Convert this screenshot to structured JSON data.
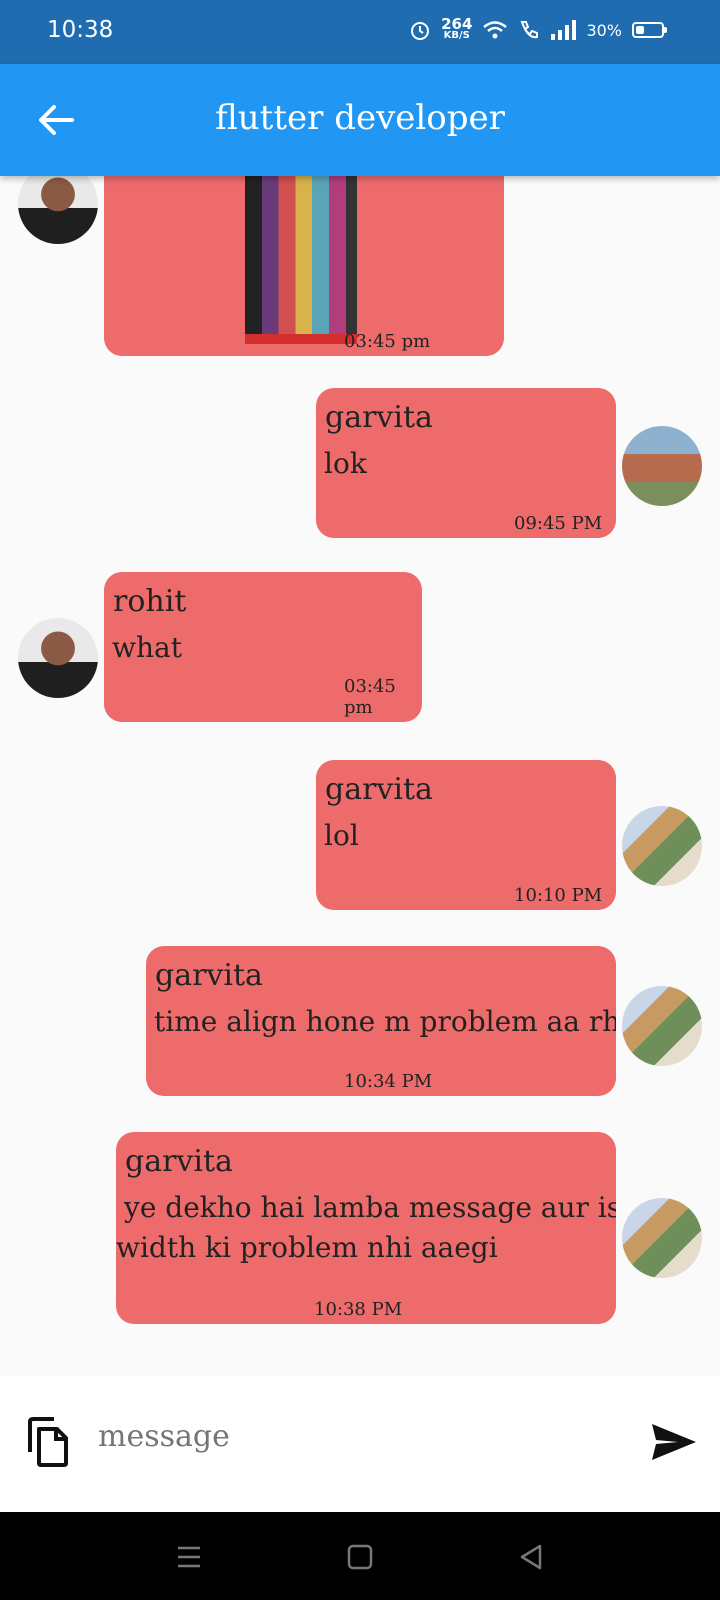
{
  "status": {
    "time": "10:38",
    "speed_value": "264",
    "speed_unit": "KB/S",
    "battery": "30%"
  },
  "appbar": {
    "title": "flutter developer"
  },
  "messages": [
    {
      "time": "03:45 pm"
    },
    {
      "name": "garvita",
      "text": "lok",
      "time": "09:45 PM"
    },
    {
      "name": "rohit",
      "text": "what",
      "time": "03:45 pm"
    },
    {
      "name": "garvita",
      "text": "lol",
      "time": "10:10 PM"
    },
    {
      "name": "garvita",
      "text": "time align hone m problem aa rhi h",
      "time": "10:34 PM"
    },
    {
      "name": "garvita",
      "text_line1": "ye dekho hai lamba message aur isme",
      "text_line2": "width ki problem nhi aaegi",
      "time": "10:38 PM"
    }
  ],
  "input": {
    "placeholder": "message"
  },
  "colors": {
    "appbar": "#2196f3",
    "statusbar": "#1f6cb0",
    "bubble": "#ee6b6b"
  }
}
